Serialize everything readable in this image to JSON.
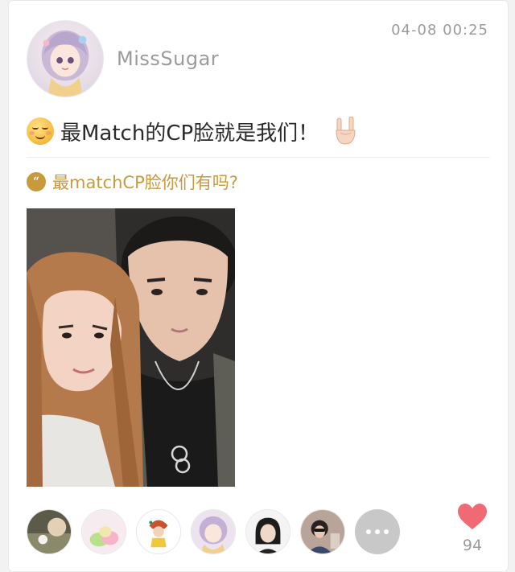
{
  "post": {
    "username": "MissSugar",
    "timestamp": "04-08 00:25",
    "title": "最Match的CP脸就是我们！",
    "title_icons": [
      "relieved-face-emoji",
      "rock-on-hand-emoji"
    ],
    "topic": "最matchCP脸你们有吗?",
    "topic_icon": "quote-bubble-icon"
  },
  "likes": {
    "count": "94",
    "heart_color": "#f06a73",
    "likers": [
      "liker-avatar-1",
      "liker-avatar-2",
      "liker-avatar-3",
      "liker-avatar-4",
      "liker-avatar-5",
      "liker-avatar-6"
    ],
    "more_icon": "more-dots-icon"
  },
  "colors": {
    "topic": "#c99a3c",
    "meta_gray": "#9b9b9b",
    "title_text": "#2a2a2a"
  }
}
